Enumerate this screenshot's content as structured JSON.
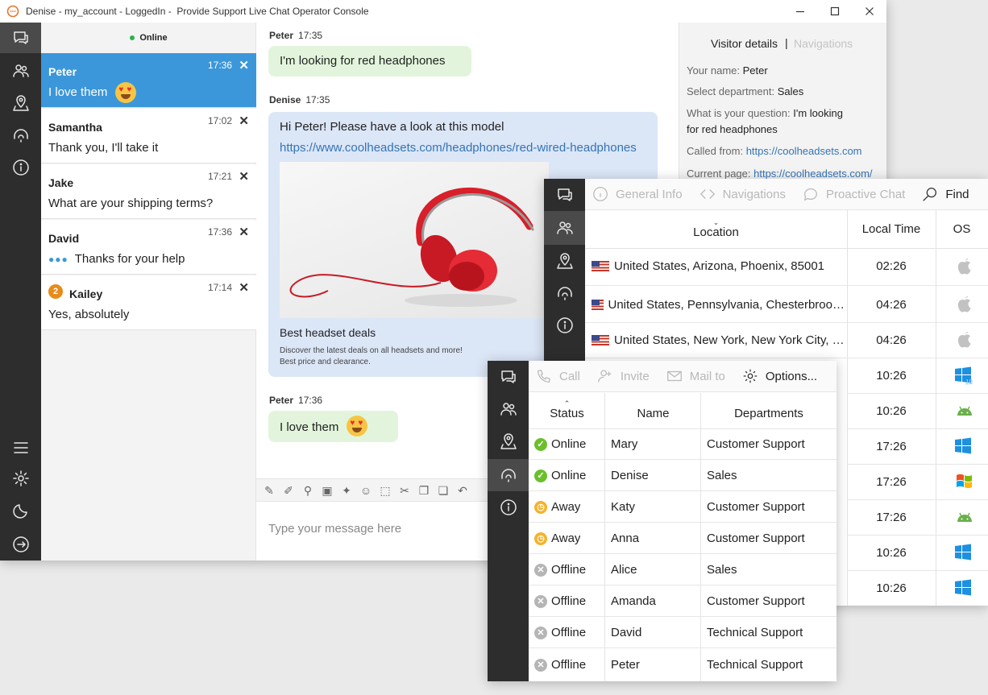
{
  "window": {
    "title": "Denise - my_account - LoggedIn -  Provide Support Live Chat Operator Console"
  },
  "status": "Online",
  "chats": [
    {
      "name": "Peter",
      "time": "17:36",
      "message": "I love them",
      "selected": true
    },
    {
      "name": "Samantha",
      "time": "17:02",
      "message": "Thank you, I'll take it"
    },
    {
      "name": "Jake",
      "time": "17:21",
      "message": "What are your shipping terms?"
    },
    {
      "name": "David",
      "time": "17:36",
      "message": "Thanks for your help",
      "typing": true
    },
    {
      "name": "Kailey",
      "time": "17:14",
      "message": "Yes, absolutely",
      "badge": "2"
    }
  ],
  "conversation": {
    "m1": {
      "sender": "Peter",
      "time": "17:35",
      "text": "I'm looking for red headphones"
    },
    "m2": {
      "sender": "Denise",
      "time": "17:35",
      "text": "Hi Peter! Please have a look at this model",
      "link": "https://www.coolheadsets.com/headphones/red-wired-headphones",
      "card_title": "Best headset deals",
      "card_desc_1": "Discover the latest deals on all headsets and more!",
      "card_desc_2": "Best price and clearance."
    },
    "m3": {
      "sender": "Peter",
      "time": "17:36",
      "text": "I love them"
    }
  },
  "composer": {
    "placeholder": "Type your message here"
  },
  "details": {
    "tab_active": "Visitor details",
    "tab_inactive": "Navigations",
    "name_label": "Your name:",
    "name_value": "Peter",
    "dept_label": "Select department:",
    "dept_value": "Sales",
    "question_label": "What is your question:",
    "question_value": "I'm looking",
    "question_value_2": "for red headphones",
    "called_label": "Called from:",
    "called_value": "https://coolheadsets.com",
    "page_label": "Current page:",
    "page_value": "https://coolheadsets.com/"
  },
  "visitors": {
    "toolbar": [
      "General Info",
      "Navigations",
      "Proactive Chat",
      "Find"
    ],
    "headers": {
      "location": "Location",
      "time": "Local Time",
      "os": "OS"
    },
    "rows": [
      {
        "location": "United States, Arizona, Phoenix, 85001",
        "time": "02:26",
        "os": "apple"
      },
      {
        "location": "United States, Pennsylvania, Chesterbroo…",
        "time": "04:26",
        "os": "apple"
      },
      {
        "location": "United States, New York, New York City, …",
        "time": "04:26",
        "os": "apple"
      },
      {
        "time": "10:26",
        "os": "windows10"
      },
      {
        "time": "10:26",
        "os": "android"
      },
      {
        "time": "17:26",
        "os": "windows10"
      },
      {
        "time": "17:26",
        "os": "windows-xp"
      },
      {
        "time": "17:26",
        "os": "android"
      },
      {
        "time": "10:26",
        "os": "windows10"
      },
      {
        "time": "10:26",
        "os": "windows10"
      }
    ]
  },
  "operators": {
    "toolbar": [
      "Call",
      "Invite",
      "Mail to",
      "Options..."
    ],
    "headers": {
      "status": "Status",
      "name": "Name",
      "dept": "Departments"
    },
    "rows": [
      {
        "status": "Online",
        "name": "Mary",
        "dept": "Customer Support"
      },
      {
        "status": "Online",
        "name": "Denise",
        "dept": "Sales"
      },
      {
        "status": "Away",
        "name": "Katy",
        "dept": "Customer Support"
      },
      {
        "status": "Away",
        "name": "Anna",
        "dept": "Customer Support"
      },
      {
        "status": "Offline",
        "name": "Alice",
        "dept": "Sales"
      },
      {
        "status": "Offline",
        "name": "Amanda",
        "dept": "Customer Support"
      },
      {
        "status": "Offline",
        "name": "David",
        "dept": "Technical Support"
      },
      {
        "status": "Offline",
        "name": "Peter",
        "dept": "Technical Support"
      }
    ]
  },
  "colors": {
    "accent": "#3b97d9",
    "rail": "#2d2d2d",
    "online": "#6bbf2b",
    "away": "#f5b22b",
    "offline": "#b5b5b5"
  }
}
